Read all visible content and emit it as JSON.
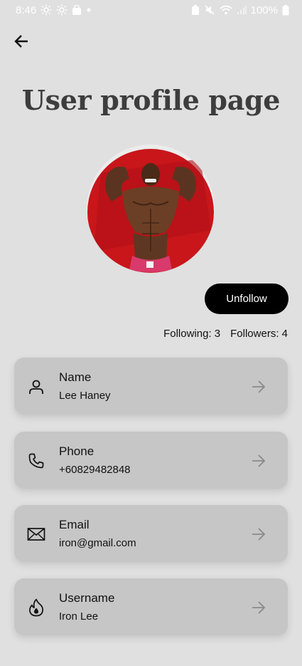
{
  "status_bar": {
    "time": "8:46",
    "battery": "100%"
  },
  "header": {
    "title": "User profile page"
  },
  "profile": {
    "unfollow_label": "Unfollow",
    "following_text": "Following: 3",
    "followers_text": "Followers: 4"
  },
  "fields": [
    {
      "label": "Name",
      "value": "Lee Haney",
      "icon": "person-icon"
    },
    {
      "label": "Phone",
      "value": "+60829482848",
      "icon": "phone-icon"
    },
    {
      "label": "Email",
      "value": "iron@gmail.com",
      "icon": "mail-icon"
    },
    {
      "label": "Username",
      "value": "Iron Lee",
      "icon": "fire-icon"
    }
  ],
  "colors": {
    "background": "#e0e0e0",
    "card": "#c6c6c6",
    "button": "#000000",
    "avatar_bg": "#c8161b"
  }
}
